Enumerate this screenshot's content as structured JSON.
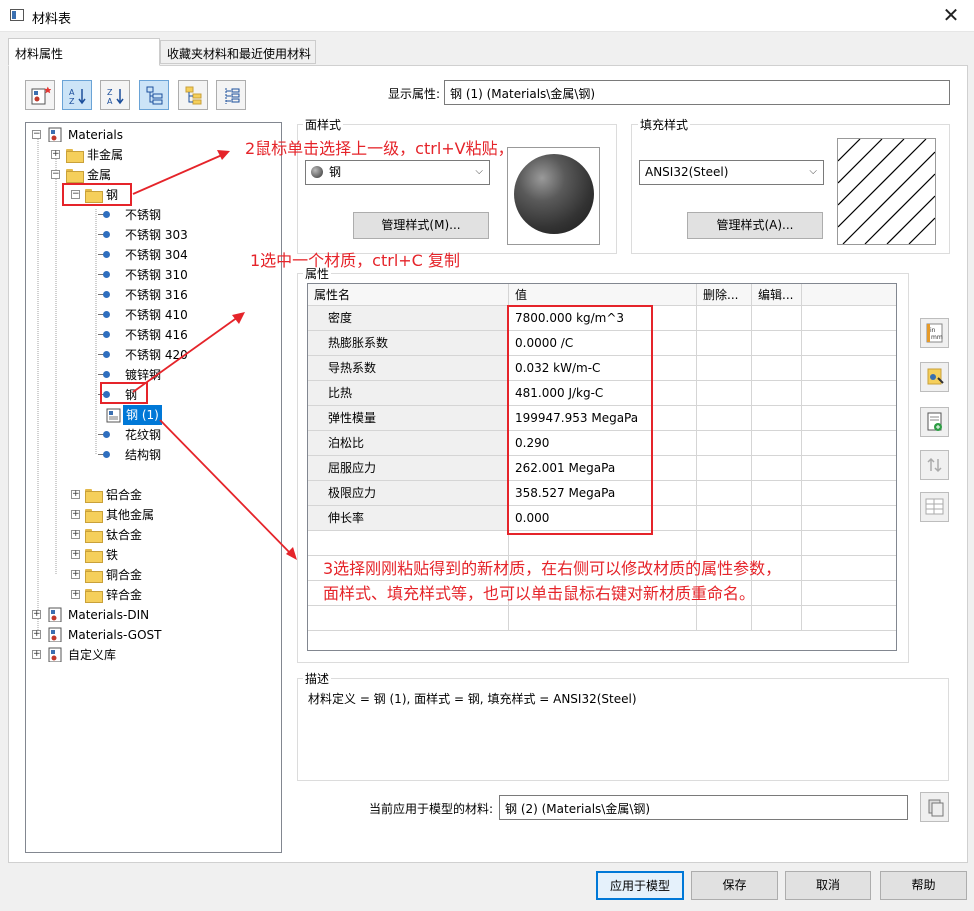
{
  "window": {
    "title": "材料表",
    "close_glyph": "✕"
  },
  "tabs": [
    {
      "label": "材料属性",
      "active": true
    },
    {
      "label": "收藏夹材料和最近使用材料",
      "active": false
    }
  ],
  "toolbar": {
    "buttons": [
      "new-material-icon",
      "sort-az-icon",
      "sort-za-icon",
      "tree-view-icon",
      "folder-view-icon",
      "list-view-icon"
    ]
  },
  "tree": {
    "root": "Materials",
    "nonmetal": "非金属",
    "metal": "金属",
    "steel": "钢",
    "steel_items": [
      "不锈钢",
      "不锈钢 303",
      "不锈钢 304",
      "不锈钢 310",
      "不锈钢 316",
      "不锈钢 410",
      "不锈钢 416",
      "不锈钢 420",
      "镀锌钢",
      "钢",
      "钢 (1)",
      "花纹钢",
      "结构钢"
    ],
    "metal_folders": [
      "铝合金",
      "其他金属",
      "钛合金",
      "铁",
      "铜合金",
      "锌合金"
    ],
    "libraries": [
      "Materials-DIN",
      "Materials-GOST",
      "自定义库"
    ]
  },
  "display_property": {
    "label": "显示属性:",
    "value": "钢 (1) (Materials\\金属\\钢)"
  },
  "face_style": {
    "title": "面样式",
    "selected": "钢",
    "button": "管理样式(M)..."
  },
  "fill_style": {
    "title": "填充样式",
    "selected": "ANSI32(Steel)",
    "button": "管理样式(A)..."
  },
  "properties": {
    "title": "属性",
    "headers": [
      "属性名",
      "值",
      "删除...",
      "编辑..."
    ],
    "rows": [
      {
        "name": "密度",
        "value": "7800.000 kg/m^3"
      },
      {
        "name": "热膨胀系数",
        "value": "0.0000 /C"
      },
      {
        "name": "导热系数",
        "value": "0.032 kW/m-C"
      },
      {
        "name": "比热",
        "value": "481.000 J/kg-C"
      },
      {
        "name": "弹性模量",
        "value": "199947.953 MegaPa"
      },
      {
        "name": "泊松比",
        "value": "0.290"
      },
      {
        "name": "屈服应力",
        "value": "262.001 MegaPa"
      },
      {
        "name": "极限应力",
        "value": "358.527 MegaPa"
      },
      {
        "name": "伸长率",
        "value": "0.000"
      }
    ]
  },
  "description": {
    "title": "描述",
    "text": "材料定义 = 钢 (1), 面样式 = 钢, 填充样式 = ANSI32(Steel)"
  },
  "current_material": {
    "label": "当前应用于模型的材料:",
    "value": "钢 (2) (Materials\\金属\\钢)"
  },
  "footer": {
    "apply": "应用于模型",
    "save": "保存",
    "cancel": "取消",
    "help": "帮助"
  },
  "annotations": {
    "step2": "2鼠标单击选择上一级，ctrl+V粘贴，",
    "step1": "1选中一个材质，ctrl+C 复制",
    "step3_line1": "3选择刚刚粘贴得到的新材质，在右侧可以修改材质的属性参数，",
    "step3_line2": "面样式、填充样式等，也可以单击鼠标右键对新材质重命名。",
    "color": "#e5242a"
  }
}
